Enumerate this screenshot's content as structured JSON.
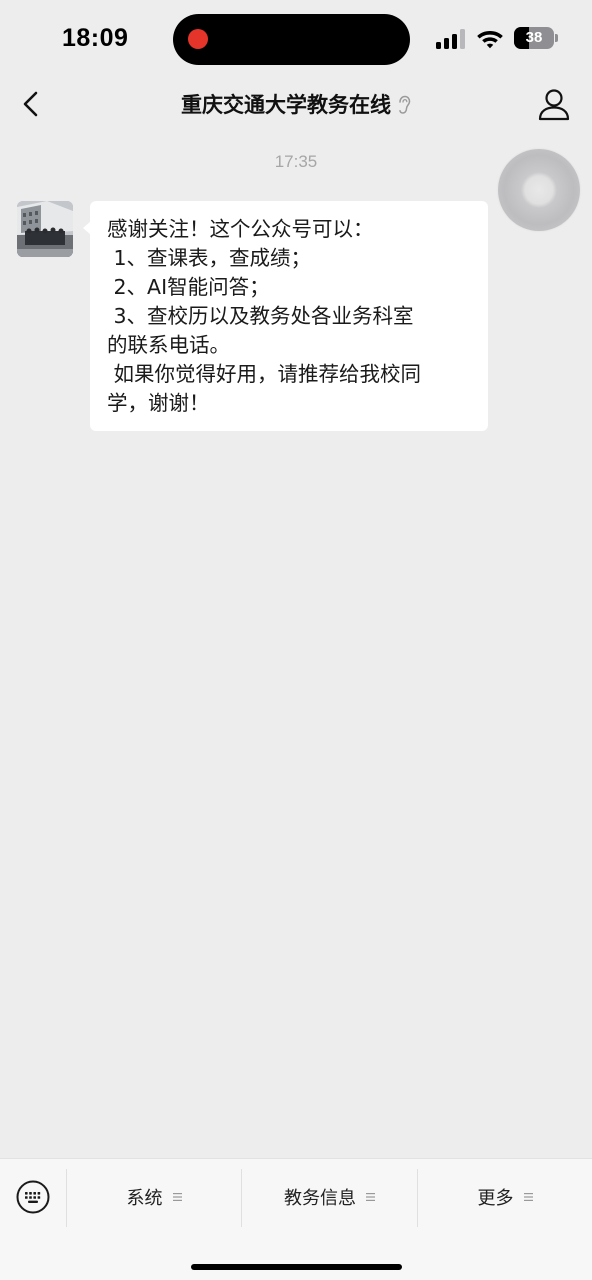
{
  "status_bar": {
    "time": "18:09",
    "battery_percent": "38",
    "battery_level": 0.38
  },
  "nav": {
    "title": "重庆交通大学教务在线"
  },
  "chat": {
    "timestamp": "17:35",
    "message_lines": [
      "感谢关注！这个公众号可以：",
      " 1、查课表，查成绩；",
      " 2、AI智能问答；",
      " 3、查校历以及教务处各业务科室",
      "的联系电话。",
      " 如果你觉得好用，请推荐给我校同",
      "学，谢谢！"
    ]
  },
  "bottom_menu": {
    "items": [
      {
        "label": "系统"
      },
      {
        "label": "教务信息"
      },
      {
        "label": "更多"
      }
    ]
  },
  "colors": {
    "background": "#ededed",
    "bubble": "#ffffff",
    "menu_bar": "#f7f7f7",
    "record_dot": "#e5352b"
  }
}
